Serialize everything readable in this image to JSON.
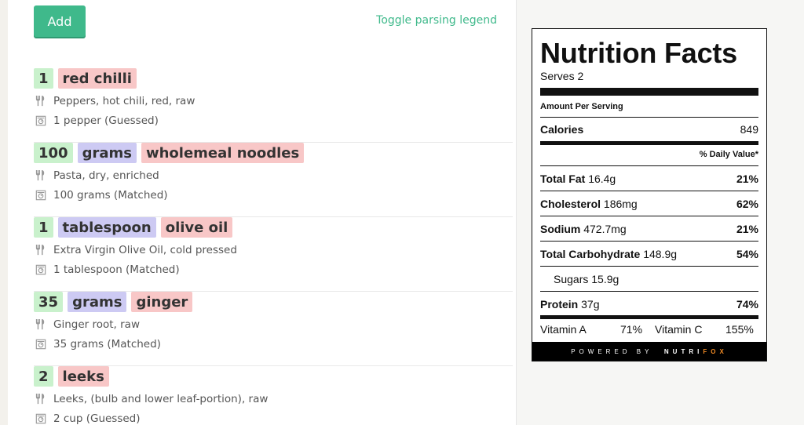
{
  "toolbar": {
    "add_label": "Add",
    "toggle_label": "Toggle parsing legend"
  },
  "ingredients": [
    {
      "chips": [
        {
          "type": "qty",
          "text": "1"
        },
        {
          "type": "food",
          "text": "red chilli"
        }
      ],
      "food_match": "Peppers, hot chili, red, raw",
      "amount_match": "1 pepper (Guessed)"
    },
    {
      "chips": [
        {
          "type": "qty",
          "text": "100"
        },
        {
          "type": "unit",
          "text": "grams"
        },
        {
          "type": "food",
          "text": "wholemeal noodles"
        }
      ],
      "food_match": "Pasta, dry, enriched",
      "amount_match": "100 grams (Matched)"
    },
    {
      "chips": [
        {
          "type": "qty",
          "text": "1"
        },
        {
          "type": "unit",
          "text": "tablespoon"
        },
        {
          "type": "food",
          "text": "olive oil"
        }
      ],
      "food_match": "Extra Virgin Olive Oil, cold pressed",
      "amount_match": "1 tablespoon (Matched)"
    },
    {
      "chips": [
        {
          "type": "qty",
          "text": "35"
        },
        {
          "type": "unit",
          "text": "grams"
        },
        {
          "type": "food",
          "text": "ginger"
        }
      ],
      "food_match": "Ginger root, raw",
      "amount_match": "35 grams (Matched)"
    },
    {
      "chips": [
        {
          "type": "qty",
          "text": "2"
        },
        {
          "type": "food",
          "text": "leeks"
        }
      ],
      "food_match": "Leeks, (bulb and lower leaf-portion), raw",
      "amount_match": "2 cup (Guessed)"
    }
  ],
  "nutrition": {
    "title": "Nutrition Facts",
    "serves": "Serves 2",
    "amount_per_serving": "Amount Per Serving",
    "calories_label": "Calories",
    "calories_value": "849",
    "daily_value_header": "% Daily Value*",
    "rows": [
      {
        "label": "Total Fat",
        "amount": "16.4g",
        "pct": "21%"
      },
      {
        "label": "Cholesterol",
        "amount": "186mg",
        "pct": "62%"
      },
      {
        "label": "Sodium",
        "amount": "472.7mg",
        "pct": "21%"
      },
      {
        "label": "Total Carbohydrate",
        "amount": "148.9g",
        "pct": "54%"
      }
    ],
    "sugars": "Sugars 15.9g",
    "protein": {
      "label": "Protein",
      "amount": "37g",
      "pct": "74%"
    },
    "vitamin_a_label": "Vitamin A",
    "vitamin_a_value": "71%",
    "vitamin_c_label": "Vitamin C",
    "vitamin_c_value": "155%",
    "footer_powered": "POWERED BY",
    "footer_nutri": "NUTRI",
    "footer_fox": "FOX"
  },
  "icons": {
    "food": "fork-knife-icon",
    "amount": "scale-icon"
  },
  "colors": {
    "accent": "#3fb98b",
    "qty_chip": "#c9f1cc",
    "unit_chip": "#cdcaf3",
    "food_chip": "#f8c7c7",
    "brand_fox": "#f08a24"
  }
}
